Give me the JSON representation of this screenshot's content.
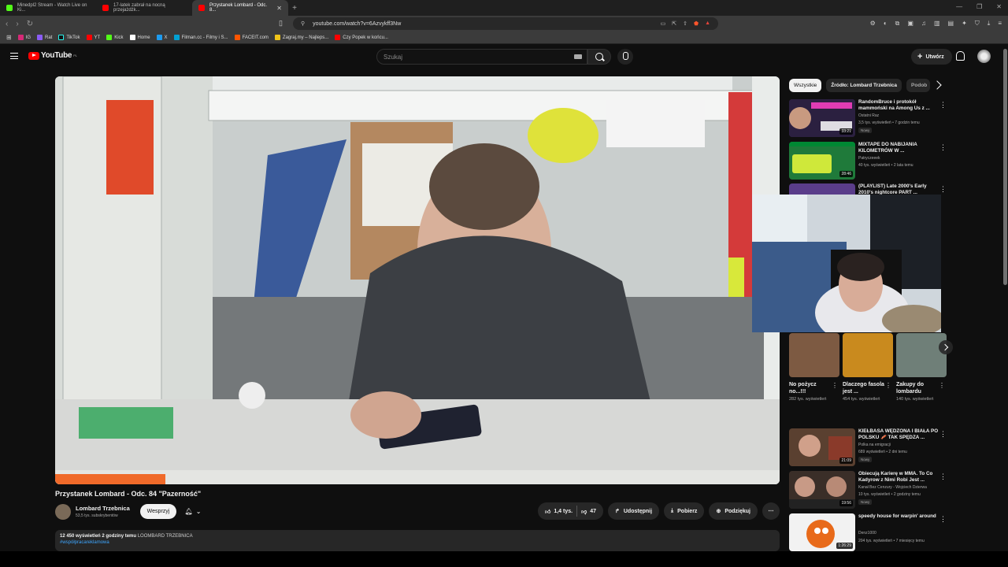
{
  "browser": {
    "tabs": [
      {
        "label": "Minedpl2 Stream - Watch Live on Ki...",
        "color": "#53fc18"
      },
      {
        "label": "17-latek zabrał na nocną przejażdżk...",
        "color": "#ff0000"
      },
      {
        "label": "Przystanek Lombard - Odc. 8...",
        "color": "#ff0000",
        "active": true
      }
    ],
    "url": "youtube.com/watch?v=6Azvykff3Nw",
    "bookmarks": [
      {
        "label": "IG",
        "color": "#d62976"
      },
      {
        "label": "Rat",
        "color": "#8b5cf6"
      },
      {
        "label": "TikTok",
        "color": "#111111"
      },
      {
        "label": "YT",
        "color": "#ff0000"
      },
      {
        "label": "Kick",
        "color": "#53fc18"
      },
      {
        "label": "Home",
        "color": "#ffffff"
      },
      {
        "label": "X",
        "color": "#1d9bf0"
      },
      {
        "label": "Filman.cc - Filmy i S...",
        "color": "#00a0d2"
      },
      {
        "label": "FACEIT.com",
        "color": "#ff5500"
      },
      {
        "label": "Zagraj.my – Najleps...",
        "color": "#f0c419"
      },
      {
        "label": "Czy Popek w końcu...",
        "color": "#ff0000"
      }
    ]
  },
  "header": {
    "logo": "YouTube",
    "logo_region": "PL",
    "search_placeholder": "Szukaj",
    "create_label": "Utwórz"
  },
  "video": {
    "title": "Przystanek Lombard - Odc. 84 \"Pazerność\"",
    "channel": "Lombard Trzebnica",
    "subscribers": "53,5 tys. subskrybentów",
    "support_label": "Wesprzyj",
    "likes": "1,4 tys.",
    "dislikes": "47",
    "share_label": "Udostępnij",
    "download_label": "Pobierz",
    "thanks_label": "Podziękuj",
    "views": "12 450 wyświetleń",
    "time": "2 godziny temu",
    "desc_channel": "LOOMBARD TRZEBNICA",
    "hashtag": "#współpracareklamowa"
  },
  "sidebar": {
    "chips": [
      "Wszystkie",
      "Źródło: Lombard Trzebnica",
      "Podob"
    ],
    "recs_top": [
      {
        "title": "RandomBruce i protokół mammoński na Among Us z ...",
        "channel": "Ostatni Raz",
        "meta": "3,5 tys. wyświetleń • 7 godzin temu",
        "badge": "Nowy",
        "duration": "33:21",
        "thumb_color": "#3b2b5a"
      },
      {
        "title": "MIXTAPE DO NABIJANIA KILOMETRÓW W ...",
        "channel": "Patryczeeek",
        "meta": "40 tys. wyświetleń • 2 lata temu",
        "badge": "",
        "duration": "28:46",
        "thumb_color": "#2d6a3e"
      },
      {
        "title": "(PLAYLIST) Late 2000's Early 2010's nightcore PART ...",
        "channel": "",
        "meta": "",
        "badge": "",
        "duration": "",
        "thumb_color": "#5a3d8a"
      }
    ],
    "shorts": [
      {
        "title": "No pożycz no...!!!",
        "views": "282 tys. wyświetleń",
        "color": "#7d5a42"
      },
      {
        "title": "Dlaczego fasola jest ...",
        "views": "454 tys. wyświetleń",
        "color": "#c98a1e"
      },
      {
        "title": "Zakupy do lombardu",
        "views": "140 tys. wyświetleń",
        "color": "#6f7f78"
      }
    ],
    "recs_bottom": [
      {
        "title": "KIEŁBASA WĘDZONA I BIAŁA PO POLSKU 🥓 TAK SPĘDZA ...",
        "channel": "Polka na emigracji",
        "meta": "689 wyświetleń • 2 dni temu",
        "badge": "Nowy",
        "duration": "21:09",
        "thumb_color": "#6a4b3a"
      },
      {
        "title": "Obiecują Karierę w MMA. To Co Kadyrow z Nimi Robi Jest ...",
        "channel": "Kanał Bez Cenzury - Wojciech Dzierwa",
        "meta": "10 tys. wyświetleń • 2 godziny temu",
        "badge": "Nowy",
        "duration": "19:56",
        "thumb_color": "#4a3a32"
      },
      {
        "title": "speedy house for warpin' around",
        "channel": "Denz1000",
        "meta": "204 tys. wyświetleń • 7 miesięcy temu",
        "badge": "",
        "duration": "1:26:29",
        "thumb_color": "#e8e8e8"
      }
    ]
  }
}
